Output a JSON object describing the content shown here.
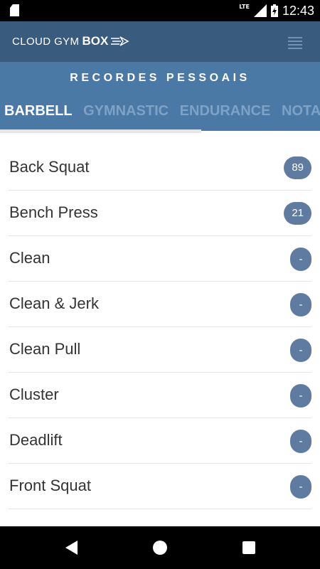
{
  "status_bar": {
    "time": "12:43",
    "network": "LTE",
    "icons": [
      "sd-card-icon",
      "signal-icon",
      "battery-charging-icon"
    ]
  },
  "app": {
    "logo_text_1": "CLOUD GYM",
    "logo_text_2": "BOX",
    "menu_icon": "hamburger-menu-icon"
  },
  "header": {
    "title": "RECORDES PESSOAIS"
  },
  "tabs": [
    {
      "label": "BARBELL",
      "active": true
    },
    {
      "label": "GYMNASTIC",
      "active": false
    },
    {
      "label": "ENDURANCE",
      "active": false
    },
    {
      "label": "NOTA",
      "active": false
    }
  ],
  "records": [
    {
      "name": "Back Squat",
      "value": "89"
    },
    {
      "name": "Bench Press",
      "value": "21"
    },
    {
      "name": "Clean",
      "value": "-"
    },
    {
      "name": "Clean & Jerk",
      "value": "-"
    },
    {
      "name": "Clean Pull",
      "value": "-"
    },
    {
      "name": "Cluster",
      "value": "-"
    },
    {
      "name": "Deadlift",
      "value": "-"
    },
    {
      "name": "Front Squat",
      "value": "-"
    }
  ],
  "navbar": {
    "icons": [
      "back-icon",
      "home-icon",
      "recents-icon"
    ]
  },
  "colors": {
    "appbar": "#395b7e",
    "header": "#4a79a6",
    "badge": "#5f7b9f"
  }
}
